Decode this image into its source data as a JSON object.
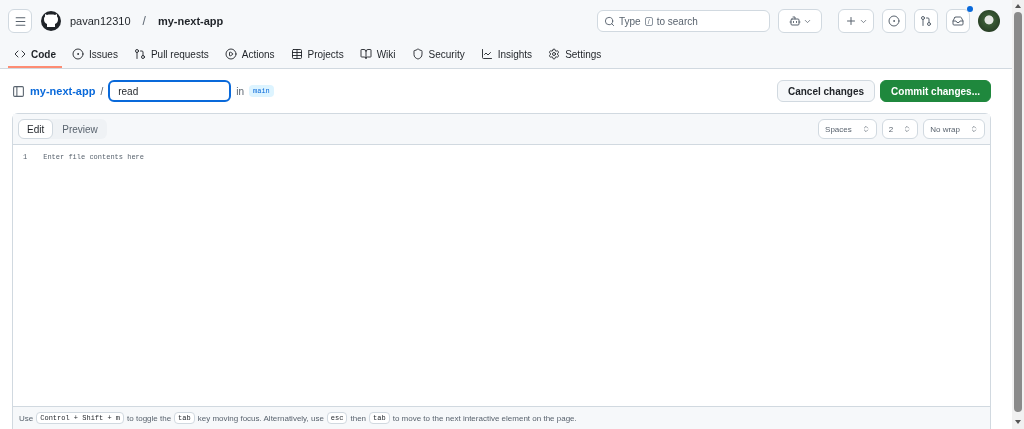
{
  "header": {
    "owner": "pavan12310",
    "separator": "/",
    "repo": "my-next-app",
    "search": {
      "placeholder_before": "Type",
      "key": "/",
      "placeholder_after": "to search"
    },
    "notifications_unread": true
  },
  "tabs": [
    {
      "label": "Code",
      "selected": true
    },
    {
      "label": "Issues",
      "selected": false
    },
    {
      "label": "Pull requests",
      "selected": false
    },
    {
      "label": "Actions",
      "selected": false
    },
    {
      "label": "Projects",
      "selected": false
    },
    {
      "label": "Wiki",
      "selected": false
    },
    {
      "label": "Security",
      "selected": false
    },
    {
      "label": "Insights",
      "selected": false
    },
    {
      "label": "Settings",
      "selected": false
    }
  ],
  "file_path": {
    "repo": "my-next-app",
    "separator": "/",
    "filename": "read",
    "in_label": "in",
    "branch": "main"
  },
  "actions": {
    "cancel": "Cancel changes",
    "commit": "Commit changes..."
  },
  "editor": {
    "modes": [
      {
        "label": "Edit",
        "selected": true
      },
      {
        "label": "Preview",
        "selected": false
      }
    ],
    "indent_mode": "Spaces",
    "indent_size": "2",
    "wrap_mode": "No wrap",
    "lines": [
      {
        "number": "1",
        "placeholder": "Enter file contents here"
      }
    ],
    "hint": [
      {
        "kind": "text",
        "text": "Use"
      },
      {
        "kind": "key",
        "text": "Control + Shift + m"
      },
      {
        "kind": "text",
        "text": "to toggle the"
      },
      {
        "kind": "key",
        "text": "tab"
      },
      {
        "kind": "text",
        "text": "key moving focus. Alternatively, use"
      },
      {
        "kind": "key",
        "text": "esc"
      },
      {
        "kind": "text",
        "text": "then"
      },
      {
        "kind": "key",
        "text": "tab"
      },
      {
        "kind": "text",
        "text": "to move to the next interactive element on the page."
      }
    ]
  }
}
